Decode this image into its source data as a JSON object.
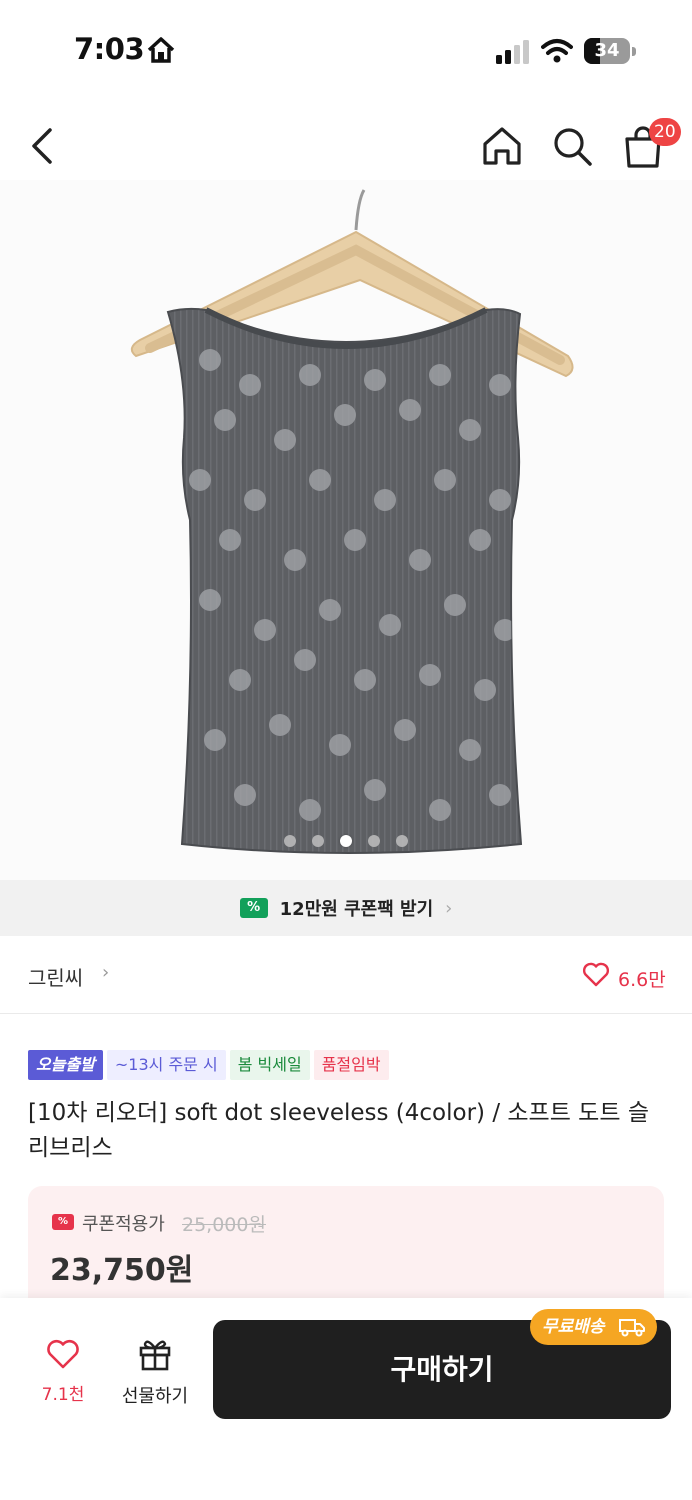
{
  "status_bar": {
    "time": "7:03",
    "battery": "34"
  },
  "header": {
    "cart_count": "20"
  },
  "product_image": {
    "alt": "grey sleeveless top with white polka dots on a wooden hanger",
    "carousel_total": 5,
    "carousel_active_index": 2
  },
  "coupon_banner": {
    "icon_text": "%",
    "text": "12만원 쿠폰팩 받기"
  },
  "seller": {
    "name": "그린씨",
    "like_count": "6.6만"
  },
  "tags": [
    {
      "label": "오늘출발"
    },
    {
      "label": "~13시 주문 시"
    },
    {
      "label": "봄 빅세일"
    },
    {
      "label": "품절임박"
    }
  ],
  "product": {
    "title": "[10차 리오더] soft dot sleeveless (4color) / 소프트 도트 슬리브리스"
  },
  "price": {
    "icon_text": "%",
    "coupon_label": "쿠폰적용가",
    "original": "25,000원",
    "final": "23,750원"
  },
  "bottom_bar": {
    "wish_count": "7.1천",
    "gift_label": "선물하기",
    "buy_label": "구매하기",
    "free_shipping": "무료배송"
  },
  "colors": {
    "accent_red": "#e6334b",
    "coupon_green": "#12a05a",
    "badge_purple": "#5b5bd6",
    "free_ship_orange": "#f5a623",
    "buy_button": "#1f1f1f"
  }
}
